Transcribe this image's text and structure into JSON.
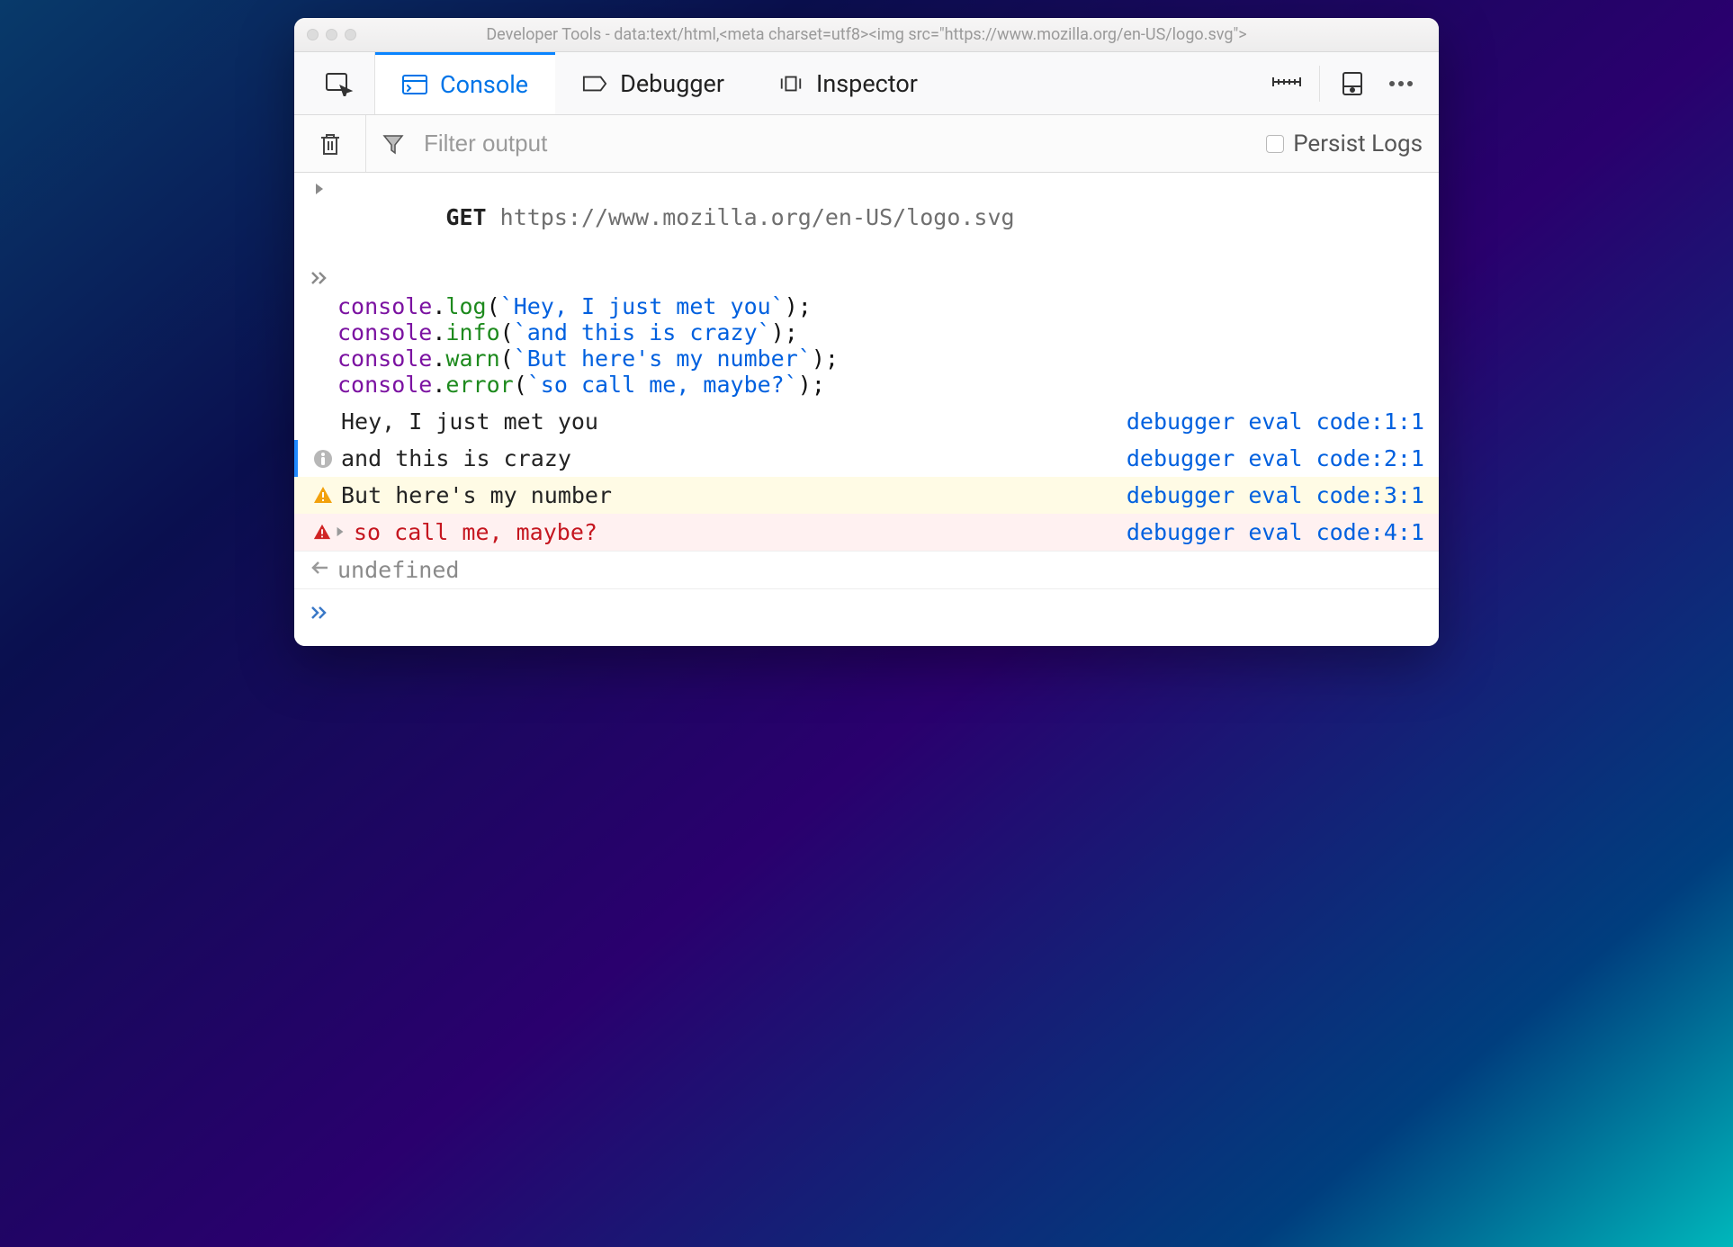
{
  "window": {
    "title": "Developer Tools - data:text/html,<meta charset=utf8><img src=\"https://www.mozilla.org/en-US/logo.svg\">"
  },
  "tabs": {
    "console": "Console",
    "debugger": "Debugger",
    "inspector": "Inspector"
  },
  "filter": {
    "placeholder": "Filter output",
    "persist_label": "Persist Logs"
  },
  "network": {
    "method": "GET",
    "url": "https://www.mozilla.org/en-US/logo.svg"
  },
  "code": {
    "line1": {
      "obj": "console",
      "fn": "log",
      "str": "`Hey, I just met you`"
    },
    "line2": {
      "obj": "console",
      "fn": "info",
      "str": "`and this is crazy`"
    },
    "line3": {
      "obj": "console",
      "fn": "warn",
      "str": "`But here's my number`"
    },
    "line4": {
      "obj": "console",
      "fn": "error",
      "str": "`so call me, maybe?`"
    }
  },
  "outputs": {
    "log": {
      "text": "Hey, I just met you",
      "loc": "debugger eval code:1:1"
    },
    "info": {
      "text": "and this is crazy",
      "loc": "debugger eval code:2:1"
    },
    "warn": {
      "text": "But here's my number",
      "loc": "debugger eval code:3:1"
    },
    "error": {
      "text": "so call me, maybe?",
      "loc": "debugger eval code:4:1"
    }
  },
  "return_value": "undefined"
}
